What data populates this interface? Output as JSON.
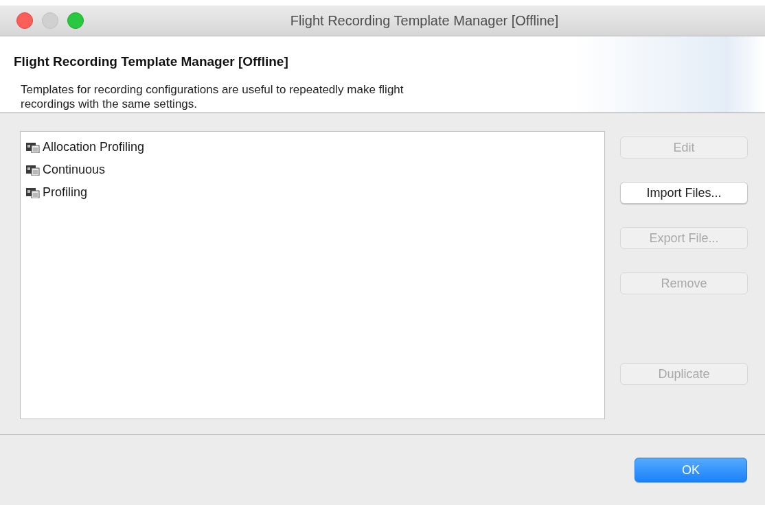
{
  "window": {
    "title": "Flight Recording Template Manager [Offline]"
  },
  "header": {
    "title": "Flight Recording Template Manager [Offline]",
    "description": "Templates for recording configurations are useful to repeatedly make flight recordings with the same settings."
  },
  "templates": [
    {
      "label": "Allocation Profiling",
      "selected": false
    },
    {
      "label": "Continuous",
      "selected": false
    },
    {
      "label": "Profiling",
      "selected": false
    }
  ],
  "side_buttons": [
    {
      "label": "Edit",
      "disabled": true
    },
    {
      "label": "Import Files...",
      "disabled": false
    },
    {
      "label": "Export File...",
      "disabled": true
    },
    {
      "label": "Remove",
      "disabled": true
    }
  ],
  "side_buttons_lower": [
    {
      "label": "Duplicate",
      "disabled": true
    }
  ],
  "footer_buttons": [
    {
      "label": "OK",
      "kind": "default"
    }
  ]
}
